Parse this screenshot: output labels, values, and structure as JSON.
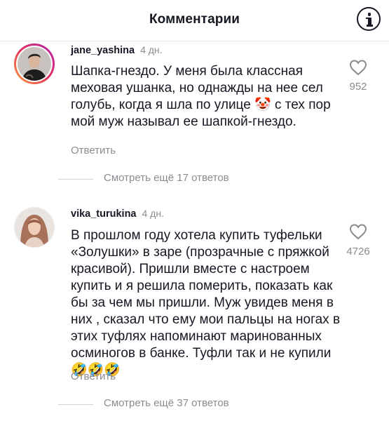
{
  "header": {
    "title": "Комментарии"
  },
  "comments": [
    {
      "username": "jane_yashina",
      "time": "4 дн.",
      "text": "Шапка-гнездо. У меня была классная меховая ушанка, но однажды на нее сел голубь, когда я шла по улице 🤡 с тех пор мой муж называл ее шапкой-гнездо.",
      "likes": "952",
      "reply_label": "Ответить",
      "more_label": "Смотреть ещё 17 ответов"
    },
    {
      "username": "vika_turukina",
      "time": "4 дн.",
      "text": "В прошлом году хотела купить туфельки «Золушки» в заре (прозрачные с пряжкой красивой). Пришли вместе с настроем купить и я решила померить, показать как бы за чем мы пришли. Муж увидев меня в них , сказал что ему мои пальцы на ногах в этих туфлях напоминают маринованных осминогов в банке. Туфли так и не купили🤣🤣🤣",
      "likes": "4726",
      "reply_label": "Ответить",
      "more_label": "Смотреть ещё 37 ответов"
    }
  ]
}
